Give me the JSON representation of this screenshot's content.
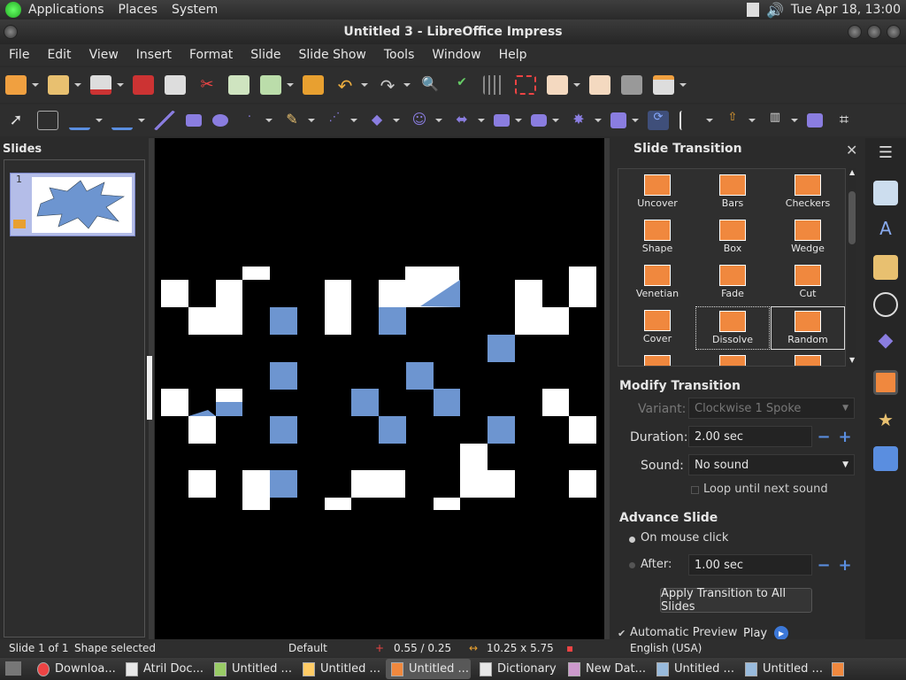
{
  "top_panel": {
    "menus": [
      "Applications",
      "Places",
      "System"
    ],
    "clock": "Tue Apr 18, 13:00"
  },
  "window": {
    "title": "Untitled 3 - LibreOffice Impress"
  },
  "menubar": [
    "File",
    "Edit",
    "View",
    "Insert",
    "Format",
    "Slide",
    "Slide Show",
    "Tools",
    "Window",
    "Help"
  ],
  "slides_pane": {
    "title": "Slides",
    "slide_number": "1"
  },
  "task_pane": {
    "title": "Slide Transition",
    "transitions": [
      "Uncover",
      "Bars",
      "Checkers",
      "Shape",
      "Box",
      "Wedge",
      "Venetian",
      "Fade",
      "Cut",
      "Cover",
      "Dissolve",
      "Random"
    ],
    "selected": "Dissolve",
    "hovered": "Random",
    "modify": {
      "title": "Modify Transition",
      "variant_label": "Variant:",
      "variant_value": "Clockwise 1 Spoke",
      "duration_label": "Duration:",
      "duration_value": "2.00 sec",
      "sound_label": "Sound:",
      "sound_value": "No sound",
      "loop_label": "Loop until next sound"
    },
    "advance": {
      "title": "Advance Slide",
      "on_click": "On mouse click",
      "after_label": "After:",
      "after_value": "1.00 sec",
      "apply_all": "Apply Transition to All Slides",
      "auto_preview": "Automatic Preview",
      "play": "Play"
    }
  },
  "status": {
    "slide": "Slide 1 of 1",
    "selection": "Shape selected",
    "layout": "Default",
    "position": "0.55 / 0.25",
    "size": "10.25 x 5.75",
    "language": "English (USA)"
  },
  "taskbar": [
    "Downloa...",
    "Atril Doc...",
    "Untitled ...",
    "Untitled ...",
    "Untitled ...",
    "Dictionary",
    "New Dat...",
    "Untitled ...",
    "Untitled ..."
  ],
  "colors": {
    "accent": "#f0883e",
    "shape_blue": "#6d95d0",
    "slide_bg": "#000000"
  }
}
